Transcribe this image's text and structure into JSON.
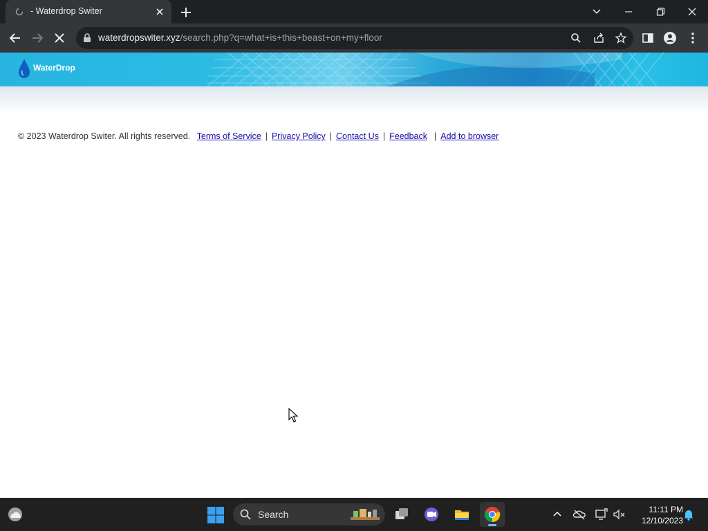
{
  "browser": {
    "tab": {
      "title": "- Waterdrop Switer"
    },
    "address_bar": {
      "host": "waterdropswiter.xyz",
      "path": "/search.php?q=what+is+this+beast+on+my+floor"
    }
  },
  "site": {
    "logo_text": "WaterDrop",
    "footer": {
      "copyright": "© 2023 Waterdrop Switer. All rights reserved.",
      "links": [
        "Terms of Service",
        "Privacy Policy",
        "Contact Us",
        "Feedback",
        "Add to browser"
      ]
    }
  },
  "taskbar": {
    "search_label": "Search",
    "time": "11:11 PM",
    "date": "12/10/2023"
  },
  "colors": {
    "chrome_dark": "#202124",
    "header_blue": "#27b5e0",
    "link_blue": "#1a0dab",
    "taskbar": "#202020"
  }
}
